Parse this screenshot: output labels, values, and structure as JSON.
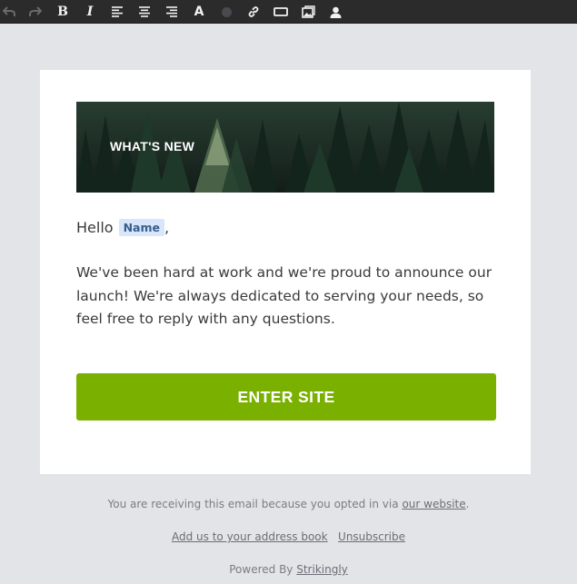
{
  "toolbar": {
    "buttons": [
      {
        "name": "undo-icon",
        "label": ""
      },
      {
        "name": "redo-icon",
        "label": ""
      },
      {
        "name": "bold-button",
        "label": "B"
      },
      {
        "name": "italic-button",
        "label": "I"
      },
      {
        "name": "align-left-icon",
        "label": ""
      },
      {
        "name": "align-center-icon",
        "label": ""
      },
      {
        "name": "align-right-icon",
        "label": ""
      },
      {
        "name": "font-style-button",
        "label": "A"
      },
      {
        "name": "text-color-icon",
        "label": ""
      },
      {
        "name": "link-icon",
        "label": ""
      },
      {
        "name": "button-icon",
        "label": ""
      },
      {
        "name": "image-icon",
        "label": ""
      },
      {
        "name": "user-icon",
        "label": ""
      }
    ],
    "text_color": "#4a4a4e"
  },
  "hero": {
    "title": "WHAT'S NEW"
  },
  "greeting": {
    "prefix": "Hello",
    "merge_tag": "Name",
    "suffix": ","
  },
  "body": {
    "text": "We've been hard at work and we're proud to announce our launch! We're always dedicated to serving your needs, so feel free to reply with any questions."
  },
  "cta": {
    "label": "ENTER SITE",
    "color": "#7ab000"
  },
  "footer": {
    "notice_prefix": "You are receiving this email because you opted in via",
    "notice_link": "our website",
    "notice_suffix": ".",
    "address_book": "Add us to your address book",
    "unsubscribe": "Unsubscribe",
    "powered_prefix": "Powered By",
    "powered_link": "Strikingly"
  }
}
